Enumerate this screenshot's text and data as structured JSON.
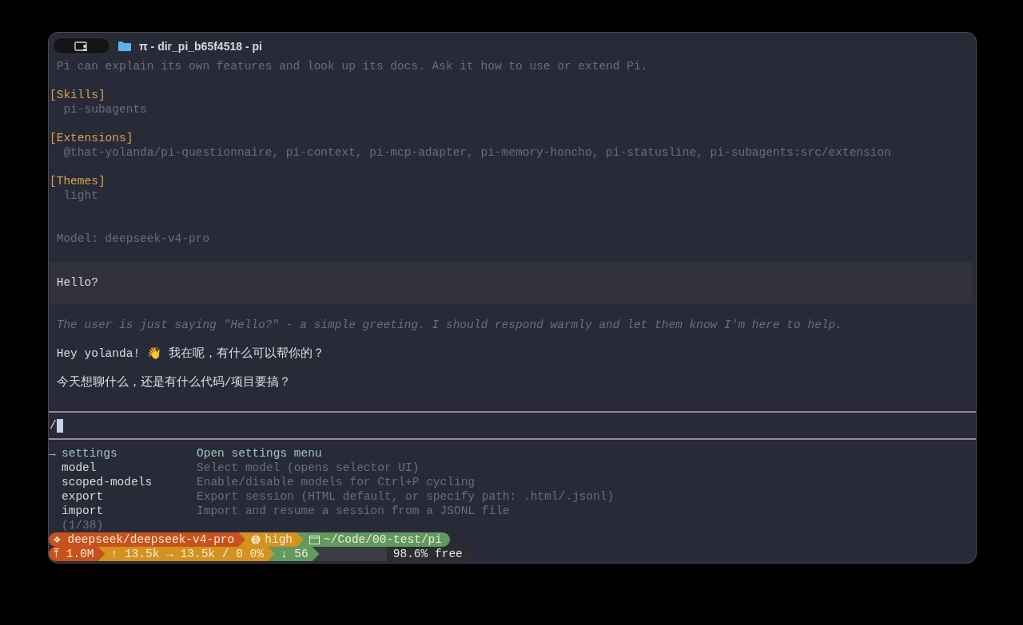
{
  "window": {
    "title": "π - dir_pi_b65f4518 - pi"
  },
  "transcript": [
    {
      "kind": "info",
      "text": "Pi can explain its own features and look up its docs. Ask it how to use or extend Pi."
    },
    {
      "kind": "section",
      "heading": "[Skills]",
      "body": "pi-subagents"
    },
    {
      "kind": "section",
      "heading": "[Extensions]",
      "body": "@that-yolanda/pi-questionnaire, pi-context, pi-mcp-adapter, pi-memory-honcho, pi-statusline, pi-subagents:src/extension"
    },
    {
      "kind": "section",
      "heading": "[Themes]",
      "body": "light"
    },
    {
      "kind": "model",
      "text": "Model: deepseek-v4-pro"
    },
    {
      "kind": "user",
      "text": "Hello?"
    },
    {
      "kind": "thinking",
      "text": "The user is just saying \"Hello?\" - a simple greeting. I should respond warmly and let them know I'm here to help."
    },
    {
      "kind": "assistant",
      "text": "Hey yolanda! 👋 我在呢，有什么可以帮你的？"
    },
    {
      "kind": "assistant",
      "text": "今天想聊什么，还是有什么代码/项目要搞？"
    }
  ],
  "prompt": {
    "value": "/"
  },
  "commands": [
    {
      "name": "settings",
      "description": "Open settings menu",
      "selected": true
    },
    {
      "name": "model",
      "description": "Select model (opens selector UI)",
      "selected": false
    },
    {
      "name": "scoped-models",
      "description": "Enable/disable models for Ctrl+P cycling",
      "selected": false
    },
    {
      "name": "export",
      "description": "Export session (HTML default, or specify path: .html/.jsonl)",
      "selected": false
    },
    {
      "name": "import",
      "description": "Import and resume a session from a JSONL file",
      "selected": false
    }
  ],
  "selection_marker": "→",
  "command_count": "(1/38)",
  "status_lines": [
    [
      {
        "kind": "text",
        "text": "❖ deepseek/deepseek-v4-pro",
        "color": "#c8521c"
      },
      {
        "kind": "thinking",
        "text": "high",
        "color": "#d4921e"
      },
      {
        "kind": "path",
        "text": "~/Code/00-test/pi",
        "color": "#5f9a5f"
      }
    ],
    [
      {
        "kind": "text",
        "text": "⤒ 1.0M",
        "color": "#c8521c"
      },
      {
        "kind": "text",
        "text": "↑ 13.5k → 13.5k / 0 0%",
        "color": "#d4921e"
      },
      {
        "kind": "text",
        "text": "↓ 56",
        "color": "#5f9a5f"
      },
      {
        "kind": "context",
        "text": "98.6% free",
        "color": "#2c2c31"
      }
    ]
  ]
}
